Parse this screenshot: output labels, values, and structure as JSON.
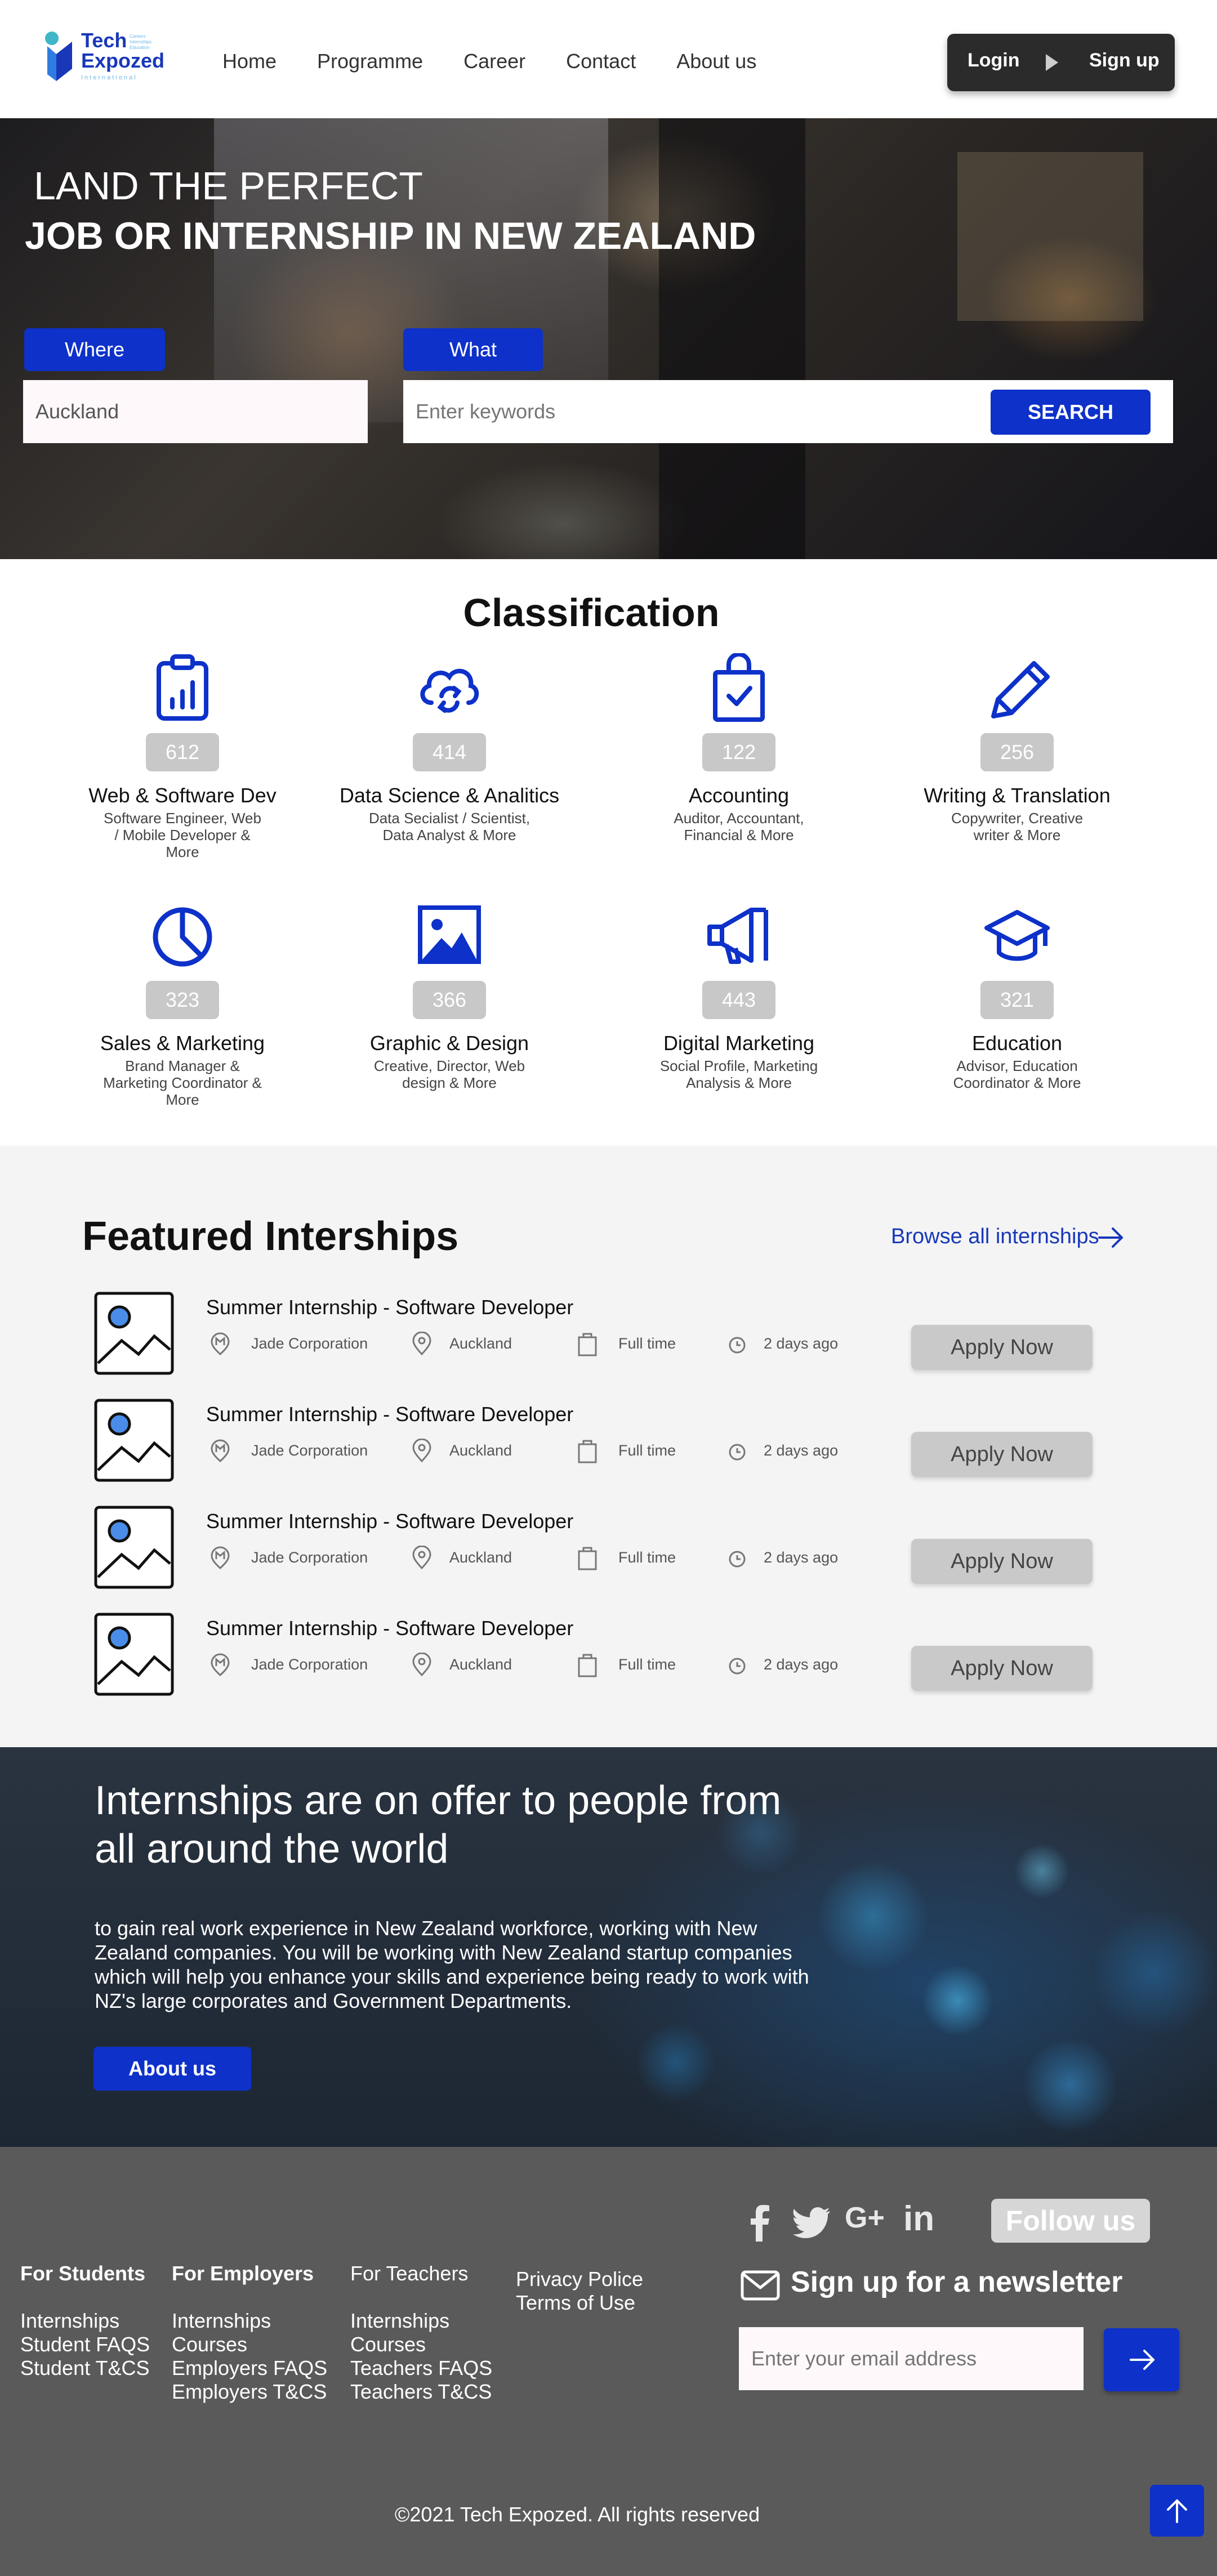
{
  "header": {
    "logo": {
      "line1": "Tech",
      "line2": "Expozed",
      "sub": "International",
      "tag": "Careers Internships Education"
    },
    "nav": [
      "Home",
      "Programme",
      "Career",
      "Contact",
      "About us"
    ],
    "login": "Login",
    "signup": "Sign up"
  },
  "hero": {
    "title_line1": "LAND THE PERFECT",
    "title_line2": "JOB OR INTERNSHIP IN NEW ZEALAND",
    "where_label": "Where",
    "where_value": "Auckland",
    "what_label": "What",
    "what_placeholder": "Enter keywords",
    "search_label": "SEARCH"
  },
  "classification": {
    "title": "Classification",
    "items": [
      {
        "icon": "clipboard-chart-icon",
        "count": "612",
        "name": "Web & Software Dev",
        "desc": "Software Engineer, Web / Mobile Developer & More"
      },
      {
        "icon": "cloud-sync-icon",
        "count": "414",
        "name": "Data Science & Analitics",
        "desc": "Data Secialist / Scientist, Data Analyst & More"
      },
      {
        "icon": "shopping-bag-check-icon",
        "count": "122",
        "name": "Accounting",
        "desc": "Auditor, Accountant, Financial & More"
      },
      {
        "icon": "pencil-icon",
        "count": "256",
        "name": "Writing & Translation",
        "desc": "Copywriter, Creative writer & More"
      },
      {
        "icon": "pie-chart-icon",
        "count": "323",
        "name": "Sales & Marketing",
        "desc": "Brand Manager & Marketing Coordinator & More"
      },
      {
        "icon": "image-icon",
        "count": "366",
        "name": "Graphic & Design",
        "desc": "Creative, Director, Web design & More"
      },
      {
        "icon": "megaphone-icon",
        "count": "443",
        "name": "Digital Marketing",
        "desc": "Social Profile, Marketing Analysis & More"
      },
      {
        "icon": "graduation-cap-icon",
        "count": "321",
        "name": "Education",
        "desc": "Advisor, Education Coordinator & More"
      }
    ]
  },
  "featured": {
    "title": "Featured Interships",
    "browse": "Browse all internships",
    "jobs": [
      {
        "title": "Summer Internship -  Software Developer",
        "company": "Jade Corporation",
        "location": "Auckland",
        "type": "Full time",
        "posted": "2 days ago",
        "apply": "Apply Now"
      },
      {
        "title": "Summer Internship -  Software Developer",
        "company": "Jade Corporation",
        "location": "Auckland",
        "type": "Full time",
        "posted": "2 days ago",
        "apply": "Apply Now"
      },
      {
        "title": "Summer Internship -  Software Developer",
        "company": "Jade Corporation",
        "location": "Auckland",
        "type": "Full time",
        "posted": "2 days ago",
        "apply": "Apply Now"
      },
      {
        "title": "Summer Internship -  Software Developer",
        "company": "Jade Corporation",
        "location": "Auckland",
        "type": "Full time",
        "posted": "2 days ago",
        "apply": "Apply Now"
      }
    ]
  },
  "about": {
    "title": "Internships are on offer to people from all around the world",
    "text": "to gain real work experience in New Zealand workforce, working with New Zealand companies. You will be working with New Zealand startup companies which will help you enhance your skills and experience being ready to work with NZ's large corporates and Government Departments.",
    "button": "About us"
  },
  "footer": {
    "social": [
      "facebook-icon",
      "twitter-icon",
      "google-plus-icon",
      "linkedin-icon"
    ],
    "google_plus_text": "G+",
    "linkedin_text": "in",
    "follow": "Follow us",
    "students": {
      "head": "For Students",
      "links": [
        "Internships",
        "Student FAQS",
        "Student T&CS"
      ]
    },
    "employers": {
      "head": "For Employers",
      "links": [
        "Internships",
        "Courses",
        "Employers FAQS",
        "Employers T&CS"
      ]
    },
    "teachers": {
      "head": "For Teachers",
      "links": [
        "Internships",
        "Courses",
        "Teachers FAQS",
        "Teachers T&CS"
      ]
    },
    "legal": [
      "Privacy Police",
      "Terms of Use"
    ],
    "newsletter_title": "Sign up for a newsletter",
    "email_placeholder": "Enter your email address",
    "copyright": "©2021 Tech Expozed. All rights reserved"
  },
  "colors": {
    "brand_blue": "#0d31c9",
    "logo_blue": "#1838b8",
    "footer_bg": "#5a5a5a",
    "section_bg": "#f4f4f4"
  }
}
